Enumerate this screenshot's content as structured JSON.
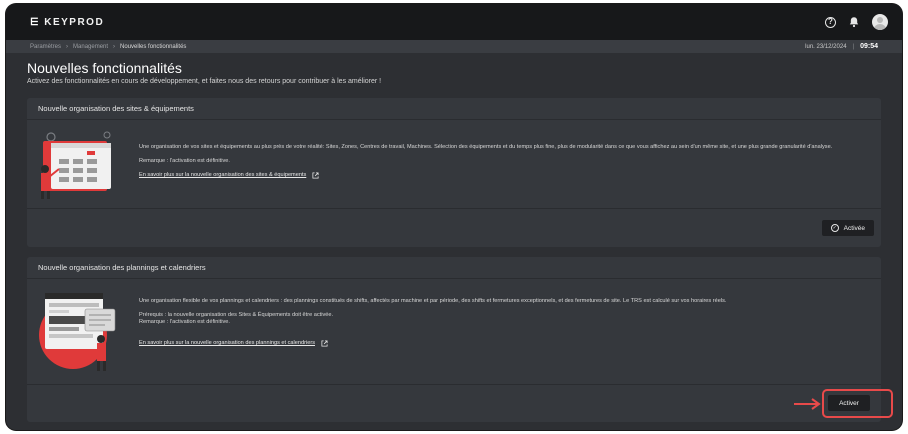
{
  "app": {
    "logo_text": "KEYPROD",
    "logo_mark": "⋿",
    "accent": "#e03a3a"
  },
  "header": {
    "help_icon": "question-circle-icon",
    "bell_icon": "bell-icon",
    "avatar_icon": "user-avatar-icon"
  },
  "breadcrumb": {
    "items": [
      "Paramètres",
      "Management",
      "Nouvelles fonctionnalités"
    ],
    "date": "lun. 23/12/2024",
    "divider": "|",
    "time": "09:54"
  },
  "page": {
    "title": "Nouvelles fonctionnalités",
    "subtitle": "Activez des fonctionnalités en cours de développement, et faites nous des retours pour contribuer à les améliorer !"
  },
  "features": [
    {
      "title": "Nouvelle organisation des sites & équipements",
      "description": "Une organisation de vos sites et équipements au plus près de votre réalité: Sites, Zones, Centres de travail, Machines. Sélection des équipements et du temps plus fine, plus de modularité dans ce que vous affichez au sein d'un même site, et une plus grande granularité d'analyse.",
      "notes": [
        "Remarque : l'activation est définitive."
      ],
      "link_text": "En savoir plus sur la nouvelle organisation des sites & équipements",
      "button_label": "Activée",
      "status": "activated"
    },
    {
      "title": "Nouvelle organisation des plannings et calendriers",
      "description": "Une organisation flexible de vos plannings et calendriers : des plannings constitués de shifts, affectés par machine et par période, des shifts et fermetures exceptionnels, et des fermetures de site. Le TRS est calculé sur vos horaires réels.",
      "notes": [
        "Prérequis : la nouvelle organisation des Sites & Équipements doit être activée.",
        "Remarque : l'activation est définitive."
      ],
      "link_text": "En savoir plus sur la nouvelle organisation des  plannings et calendriers",
      "button_label": "Activer",
      "status": "inactive"
    }
  ],
  "annotation": {
    "color": "#e84a4a"
  }
}
